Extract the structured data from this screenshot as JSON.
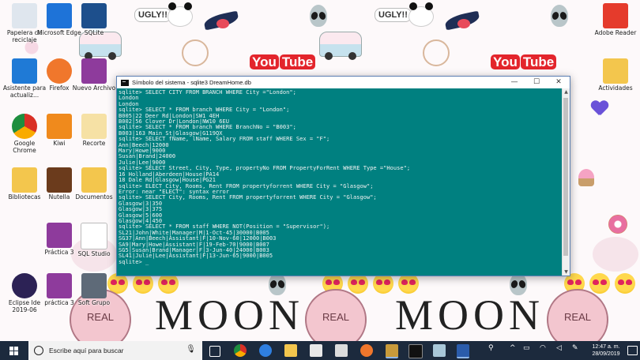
{
  "window": {
    "title": "Símbolo del sistema - sqlite3  DreamHome.db",
    "minimize": "—",
    "maximize": "☐",
    "close": "✕"
  },
  "console_lines": [
    "sqlite> SELECT CITY FROM BRANCH WHERE City =\"London\";",
    "London",
    "London",
    "sqlite> SELECT * FROM branch WHERE City = \"London\";",
    "B005|22 Deer Rd|London|SW1 4EH",
    "B002|56 Clover Dr|London|NW10 6EU",
    "sqlite> SELECT * FROM branch WHERE BranchNo = \"B003\";",
    "B003|163 Main St|Glasgow|G119QX",
    "sqlite> SELECT fName, lName, Salary FROM staff WHERE Sex = \"F\";",
    "Ann|Beech|12000",
    "Mary|Howe|9000",
    "Susan|Brand|24000",
    "Julie|Lee|9000",
    "sqlite> SELECT Street, City, Type, propertyNo FROM PropertyForRent WHERE Type =\"House\";",
    "16 Holland|Aberdeen|House|PA14",
    "18 Dale Rd|Glasgow|House|PG21",
    "sqlite> ELECT City, Rooms, Rent FROM propertyforrent WHERE City = \"Glasgow\";",
    "Error: near \"ELECT\": syntax error",
    "sqlite> SELECT City, Rooms, Rent FROM propertyforrent WHERE City = \"Glasgow\";",
    "Glasgow|3|350",
    "Glasgow|3|375",
    "Glasgow|5|600",
    "Glasgow|4|450",
    "sqlite> SELECT * FROM staff WHERE NOT(Position = \"Supervisor\");",
    "SL21|John|White|Manager|M|1-Oct-45|30000|B005",
    "SG37|Ann|Beech|Assistant|F|10-Nov-60|12000|B003",
    "SA9|Mary|Howe|Assistant|F|19-Feb-70|9000|B007",
    "SG5|Susan|Brand|Manager|F|3-Jun-40|24000|B003",
    "SL41|Julie|Lee|Assistant|F|13-Jun-65|9000|B005",
    "sqlite> _"
  ],
  "desktop_icons": [
    {
      "label": "Papelera de reciclaje",
      "icon": "recycle-bin-icon",
      "color": "#dfe6ee"
    },
    {
      "label": "Microsoft Edge",
      "icon": "edge-icon",
      "color": "#1e73d8"
    },
    {
      "label": "SQLite",
      "icon": "sqlite-icon",
      "color": "#1d4f8c"
    },
    {
      "label": "Asistente para actualiz...",
      "icon": "windows-update-icon",
      "color": "#1f7ad6"
    },
    {
      "label": "Firefox",
      "icon": "firefox-icon",
      "color": "#f0772c"
    },
    {
      "label": "Nuevo Archivo",
      "icon": "winrar-icon",
      "color": "#8e3b9c"
    },
    {
      "label": "Google Chrome",
      "icon": "chrome-icon",
      "color": "#2d9a46"
    },
    {
      "label": "Kiwi",
      "icon": "app-icon",
      "color": "#f08a1c"
    },
    {
      "label": "Recorte",
      "icon": "music-icon",
      "color": "#f6e1a5"
    },
    {
      "label": "Nutella",
      "icon": "jar-icon",
      "color": "#6b3b1c"
    },
    {
      "label": "Bibliotecas",
      "icon": "folder-icon",
      "color": "#f3c64d"
    },
    {
      "label": "Documentos",
      "icon": "folder-icon",
      "color": "#f3c64d"
    },
    {
      "label": "Práctica 3",
      "icon": "winrar-icon",
      "color": "#8e3b9c"
    },
    {
      "label": "SQL Studio",
      "icon": "document-icon",
      "color": "#ffffff"
    },
    {
      "label": "Eclipse Ide 2019-06",
      "icon": "eclipse-icon",
      "color": "#2c2255"
    },
    {
      "label": "práctica 3",
      "icon": "winrar-icon",
      "color": "#8e3b9c"
    },
    {
      "label": "Soft Grupo",
      "icon": "archive-icon",
      "color": "#5e6a78"
    },
    {
      "label": "Adobe Reader",
      "icon": "pdf-icon",
      "color": "#e53b2c"
    },
    {
      "label": "Actividades",
      "icon": "folder-icon",
      "color": "#f3c64d"
    }
  ],
  "wallpaper": {
    "youtube_text": "You",
    "youtube_tube": "Tube",
    "moon_text": "MOON",
    "real_text": "REAL",
    "ugly_text": "UGLY!!"
  },
  "taskbar": {
    "search_placeholder": "Escribe aquí para buscar",
    "time": "12:47 a. m.",
    "date": "28/09/2019",
    "apps": [
      "cortana-icon",
      "task-view-icon",
      "chrome-icon",
      "edge-icon",
      "file-explorer-icon",
      "store-icon",
      "mail-icon",
      "firefox-icon",
      "app-icon",
      "terminal-icon",
      "notes-icon",
      "word-icon"
    ]
  },
  "colors": {
    "console_bg": "#008080",
    "console_text": "#f2f2f2",
    "taskbar_bg": "#1c2a3d"
  }
}
